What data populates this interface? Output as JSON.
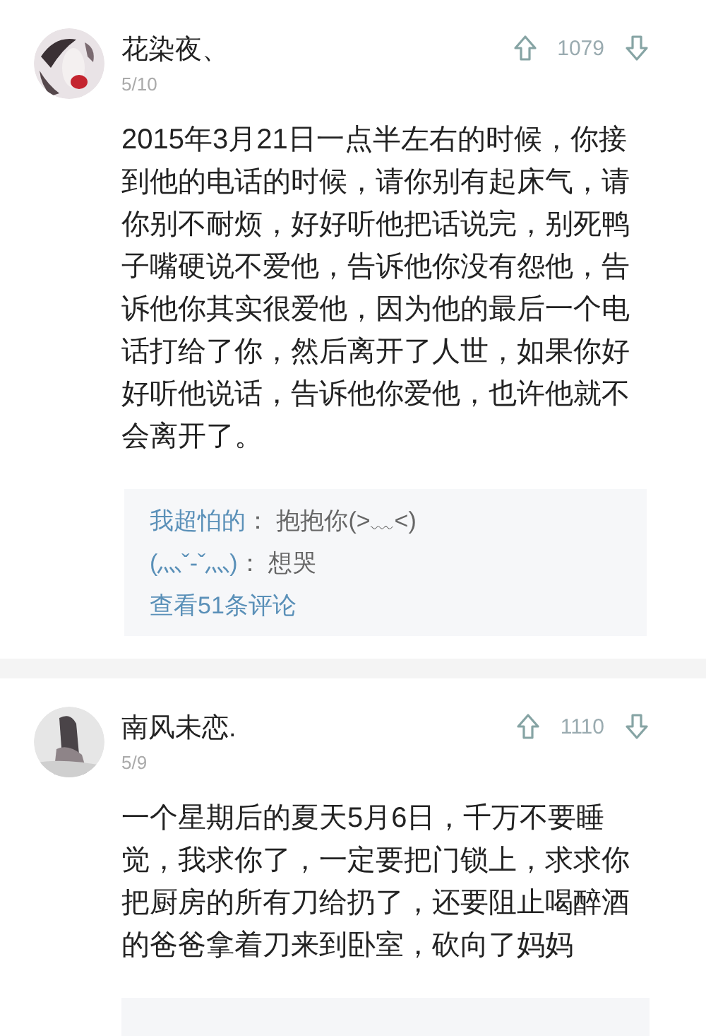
{
  "comments": [
    {
      "author": "花染夜、",
      "date": "5/10",
      "votes": "1079",
      "text": "2015年3月21日一点半左右的时候，你接到他的电话的时候，请你别有起床气，请你别不耐烦，好好听他把话说完，别死鸭子嘴硬说不爱他，告诉他你没有怨他，告诉他你其实很爱他，因为他的最后一个电话打给了你，然后离开了人世，如果你好好听他说话，告诉他你爱他，也许他就不会离开了。",
      "replies": [
        {
          "author": "我超怕的",
          "separator": "：",
          "text": "抱抱你(>﹏<)"
        },
        {
          "author": "(灬ˇ-ˇ灬)",
          "separator": "：",
          "text": "想哭"
        }
      ],
      "more_link": "查看51条评论"
    },
    {
      "author": "南风未恋.",
      "date": "5/9",
      "votes": "1110",
      "text": "一个星期后的夏天5月6日，千万不要睡觉，我求你了，一定要把门锁上，求求你把厨房的所有刀给扔了，还要阻止喝醉酒的爸爸拿着刀来到卧室，砍向了妈妈",
      "cut_reply_box": true
    }
  ]
}
